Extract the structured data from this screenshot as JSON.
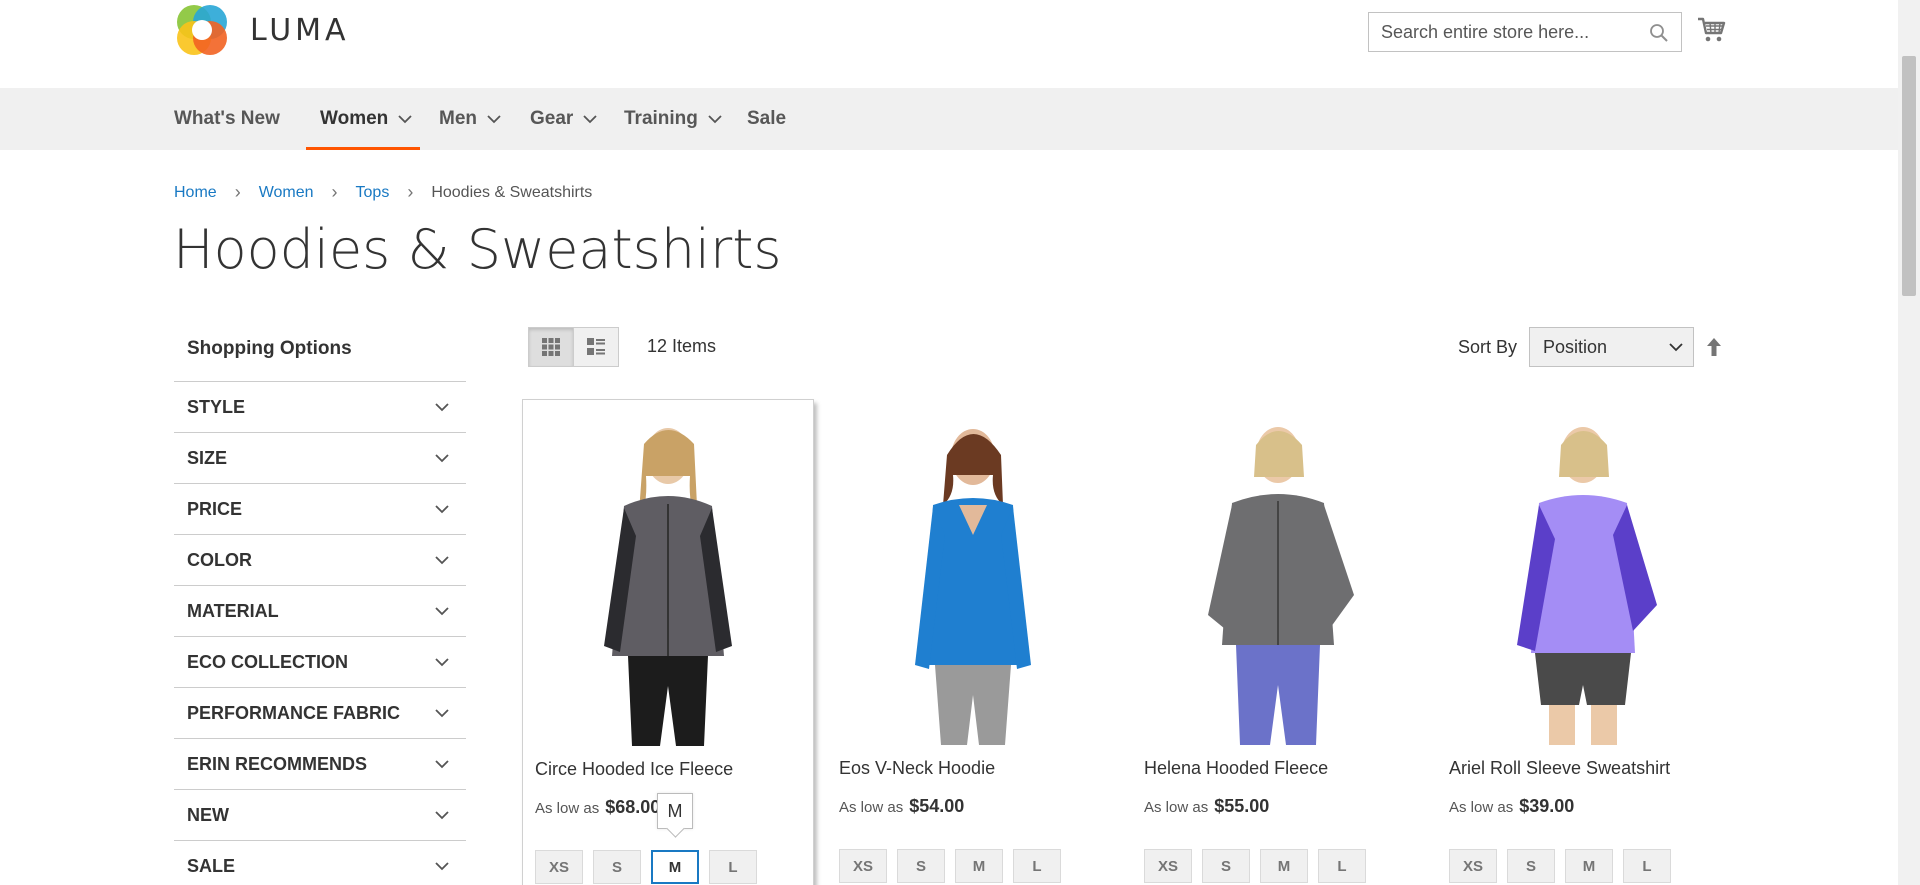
{
  "header": {
    "logo_text": "LUMA",
    "search_placeholder": "Search entire store here...",
    "cart_icon": "cart-icon"
  },
  "nav": {
    "items": [
      {
        "label": "What's New",
        "has_dropdown": false
      },
      {
        "label": "Women",
        "has_dropdown": true,
        "active": true
      },
      {
        "label": "Men",
        "has_dropdown": true
      },
      {
        "label": "Gear",
        "has_dropdown": true
      },
      {
        "label": "Training",
        "has_dropdown": true
      },
      {
        "label": "Sale",
        "has_dropdown": false
      }
    ],
    "accent_color": "#ff5501"
  },
  "breadcrumb": {
    "items": [
      "Home",
      "Women",
      "Tops"
    ],
    "current": "Hoodies & Sweatshirts"
  },
  "page_title": "Hoodies & Sweatshirts",
  "sidebar": {
    "title": "Shopping Options",
    "filters": [
      "STYLE",
      "SIZE",
      "PRICE",
      "COLOR",
      "MATERIAL",
      "ECO COLLECTION",
      "PERFORMANCE FABRIC",
      "ERIN RECOMMENDS",
      "NEW",
      "SALE"
    ]
  },
  "toolbar": {
    "items_count": "12 Items",
    "sort_label": "Sort By",
    "sort_value": "Position"
  },
  "products": [
    {
      "name": "Circe Hooded Ice Fleece",
      "price_label": "As low as",
      "price": "$68.00",
      "sizes": [
        "XS",
        "S",
        "M",
        "L"
      ],
      "selected_size": "M",
      "colors": {
        "top": "#5f5d63",
        "sleeve": "#2b2b2f",
        "pants": "#1c1c1c"
      }
    },
    {
      "name": "Eos V-Neck Hoodie",
      "price_label": "As low as",
      "price": "$54.00",
      "sizes": [
        "XS",
        "S",
        "M",
        "L"
      ],
      "colors": {
        "top": "#1f7fd0",
        "sleeve": "#1f7fd0",
        "pants": "#9a9a9a"
      }
    },
    {
      "name": "Helena Hooded Fleece",
      "price_label": "As low as",
      "price": "$55.00",
      "sizes": [
        "XS",
        "S",
        "M",
        "L"
      ],
      "colors": {
        "top": "#6e6e70",
        "sleeve": "#6e6e70",
        "pants": "#6b72c9"
      }
    },
    {
      "name": "Ariel Roll Sleeve Sweatshirt",
      "price_label": "As low as",
      "price": "$39.00",
      "sizes": [
        "XS",
        "S",
        "M",
        "L"
      ],
      "colors": {
        "top": "#a48df5",
        "sleeve": "#5b3fc9",
        "pants": "#4a4a4a"
      }
    }
  ],
  "tooltip": {
    "text": "M"
  },
  "colors": {
    "link": "#1979c3",
    "nav_bg": "#f0f0f0",
    "accent": "#ff5501"
  }
}
